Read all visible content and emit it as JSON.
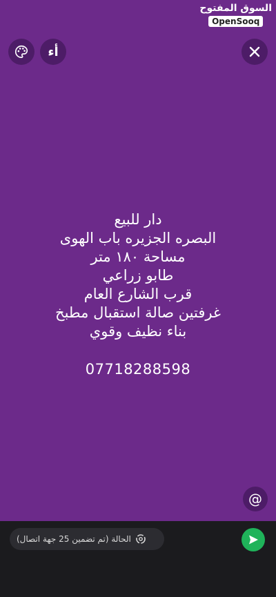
{
  "watermark": {
    "arabic": "السوق المفتوح",
    "english": "OpenSooq"
  },
  "toolbar": {
    "font_label": "أء"
  },
  "status": {
    "lines": [
      "دار للبيع",
      "البصره الجزيره باب الهوى",
      "مساحة ١٨٠ متر",
      "طابو زراعي",
      "قرب الشارع العام",
      "غرفتين صالة استقبال مطبخ",
      "بناء نظيف وقوي"
    ],
    "phone": "07718288598",
    "background_color": "#6c2a8a"
  },
  "mention": {
    "symbol": "@"
  },
  "bottom_bar": {
    "audience_label": "الحالة (تم تضمين 25 جهة اتصال)",
    "send_color": "#1fb35a"
  }
}
